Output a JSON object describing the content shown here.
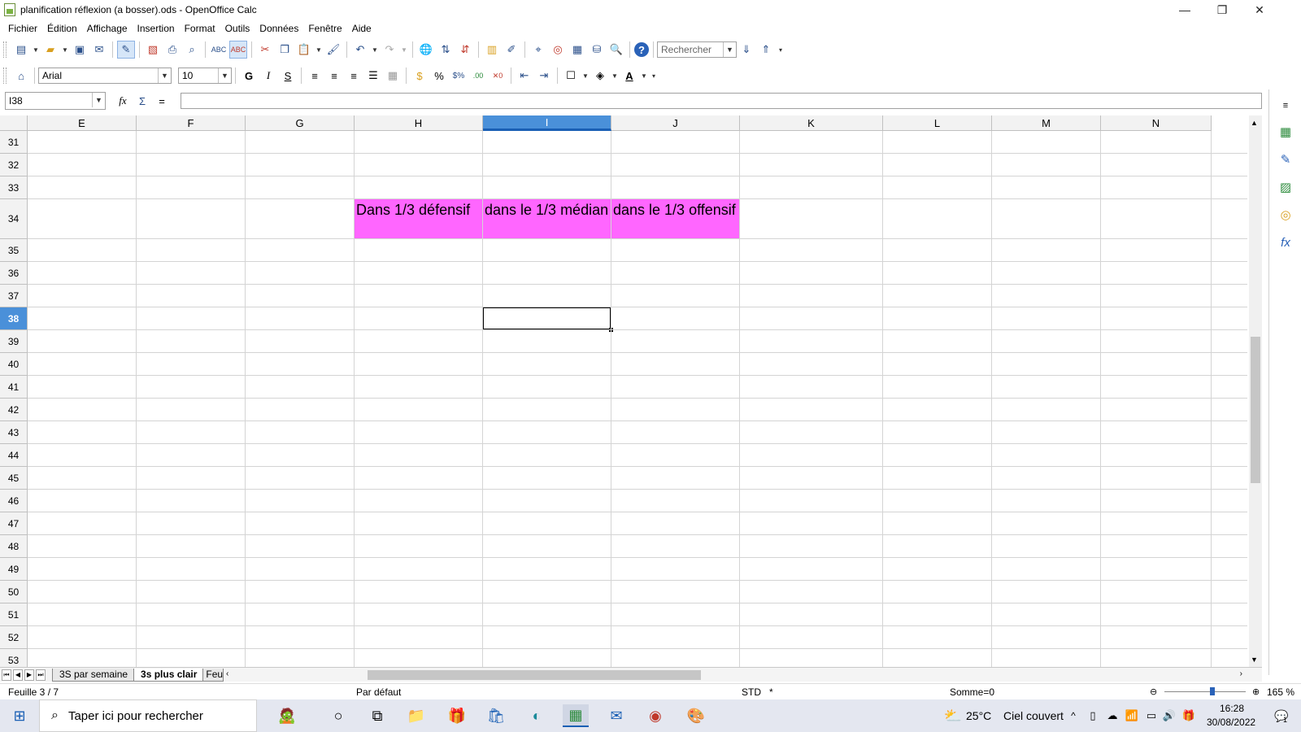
{
  "window": {
    "title": "planification réflexion (a bosser).ods - OpenOffice Calc",
    "minimize": "—",
    "restore": "❐",
    "close": "✕"
  },
  "menu": [
    "Fichier",
    "Édition",
    "Affichage",
    "Insertion",
    "Format",
    "Outils",
    "Données",
    "Fenêtre",
    "Aide"
  ],
  "toolbar": {
    "search_placeholder": "Rechercher",
    "font_name": "Arial",
    "font_size": "10"
  },
  "formula": {
    "name_box": "I38",
    "content": ""
  },
  "grid": {
    "columns": [
      "E",
      "F",
      "G",
      "H",
      "I",
      "J",
      "K",
      "L",
      "M",
      "N"
    ],
    "selected_column": "I",
    "rows": [
      "31",
      "32",
      "33",
      "34",
      "35",
      "36",
      "37",
      "38",
      "39",
      "40",
      "41",
      "42",
      "43",
      "44",
      "45",
      "46",
      "47",
      "48",
      "49",
      "50",
      "51",
      "52",
      "53"
    ],
    "selected_row": "38",
    "cells": {
      "H34": "Dans 1/3 défensif",
      "I34": "dans le 1/3 médian",
      "J34": "dans le 1/3 offensif"
    },
    "highlight_color": "#ff66ff"
  },
  "sheets": {
    "tabs": [
      "3S par semaine",
      "3s plus clair",
      "Feu"
    ],
    "active": "3s plus clair"
  },
  "status": {
    "sheet": "Feuille 3 / 7",
    "style": "Par défaut",
    "mode": "STD",
    "modified": "*",
    "sum": "Somme=0",
    "zoom": "165 %"
  },
  "taskbar": {
    "search_placeholder": "Taper ici pour rechercher",
    "weather_temp": "25°C",
    "weather_text": "Ciel couvert",
    "time": "16:28",
    "date": "30/08/2022",
    "notification_count": "1"
  }
}
